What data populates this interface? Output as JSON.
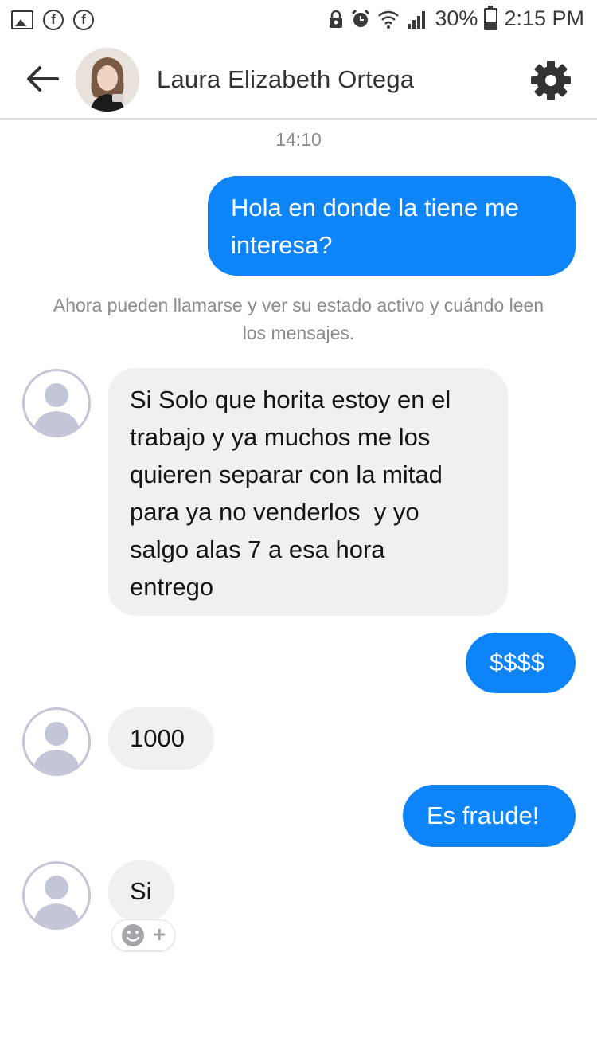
{
  "status_bar": {
    "battery": "30%",
    "time": "2:15 PM",
    "icons_left": [
      "image-icon",
      "facebook-icon",
      "facebook-icon"
    ],
    "icons_right": [
      "lock-icon",
      "alarm-icon",
      "wifi-icon",
      "signal-icon",
      "battery-icon"
    ]
  },
  "header": {
    "contact_name": "Laura Elizabeth Ortega",
    "back_icon": "arrow-left-icon",
    "settings_icon": "gear-icon"
  },
  "conversation": {
    "timestamp": "14:10",
    "system_note": "Ahora pueden llamarse y ver su estado activo y cuándo leen los mensajes.",
    "messages": [
      {
        "direction": "outgoing",
        "lines": [
          "Hola en donde la tiene me",
          "interesa?"
        ]
      },
      {
        "direction": "incoming",
        "lines": [
          "Si Solo que horita estoy en el",
          "trabajo y ya muchos me los",
          "quieren separar con la mitad",
          "para ya no venderlos  y yo",
          "salgo alas 7 a esa hora",
          "entrego"
        ]
      },
      {
        "direction": "outgoing",
        "lines": [
          "$$$$"
        ]
      },
      {
        "direction": "incoming",
        "lines": [
          "1000"
        ]
      },
      {
        "direction": "outgoing",
        "lines": [
          "Es fraude!"
        ]
      },
      {
        "direction": "incoming",
        "lines": [
          "Si"
        ]
      }
    ],
    "reaction_button": {
      "icon": "smiley-add-icon",
      "plus": "+"
    }
  },
  "colors": {
    "outgoing_bubble": "#0d85f8",
    "incoming_bubble": "#f0f0f0",
    "meta_text": "#8b8b8b"
  }
}
